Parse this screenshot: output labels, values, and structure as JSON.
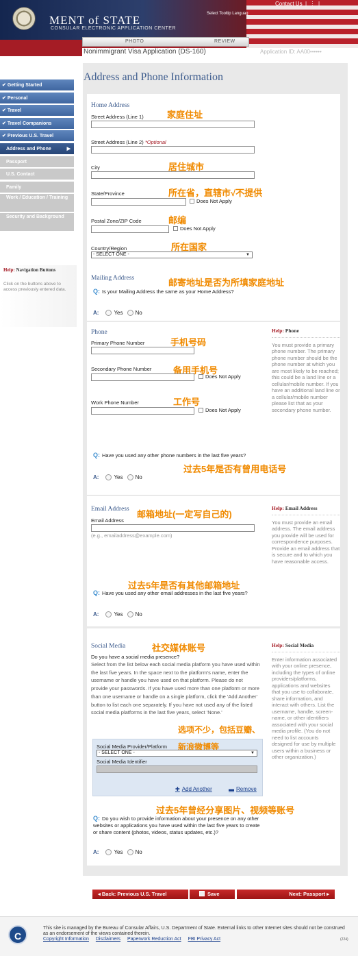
{
  "header": {
    "department": "MENT of STATE",
    "center": "CONSULAR ELECTRONIC APPLICATION CENTER",
    "contact": "Contact Us",
    "tooltip": "Select Tooltip Languag",
    "tabs": [
      "PHOTO",
      "REVIEW"
    ],
    "app_title": "Nonimmigrant Visa Application (DS-160)",
    "app_id": "Application ID: AA00••••••"
  },
  "sidebar": {
    "items": [
      {
        "label": "Getting Started",
        "state": "done"
      },
      {
        "label": "Personal",
        "state": "done"
      },
      {
        "label": "Travel",
        "state": "done"
      },
      {
        "label": "Travel Companions",
        "state": "done"
      },
      {
        "label": "Previous U.S. Travel",
        "state": "done"
      },
      {
        "label": "Address and Phone",
        "state": "current"
      },
      {
        "label": "Passport",
        "state": "pending"
      },
      {
        "label": "U.S. Contact",
        "state": "pending"
      },
      {
        "label": "Family",
        "state": "pending"
      },
      {
        "label": "Work / Education / Training",
        "state": "pending"
      },
      {
        "label": "Security and Background",
        "state": "pending"
      }
    ],
    "help_prefix": "Help:",
    "help_title": "Navigation Buttons",
    "help_text": "Click on the buttons above to access previously entered data."
  },
  "page_title": "Address and Phone Information",
  "home": {
    "heading": "Home Address",
    "street1": "Street Address (Line 1)",
    "street2": "Street Address (Line 2)",
    "optional": "*Optional",
    "city": "City",
    "state": "State/Province",
    "postal": "Postal Zone/ZIP Code",
    "country": "Country/Region",
    "does_not_apply": "Does Not Apply",
    "select_one": "- SELECT ONE -"
  },
  "mailing": {
    "heading": "Mailing Address",
    "question": "Is your Mailing Address the same as your Home Address?"
  },
  "phone": {
    "heading": "Phone",
    "primary": "Primary Phone Number",
    "secondary": "Secondary Phone Number",
    "work": "Work Phone Number",
    "question": "Have you used any other phone numbers in the last five years?",
    "help_prefix": "Help:",
    "help_title": "Phone",
    "help_text": "You must provide a primary phone number. The primary phone number should be the phone number at which you are most likely to be reached; this could be a land line or a cellular/mobile number. If you have an additional land line or a cellular/mobile number please list that as your secondary phone number."
  },
  "email": {
    "heading": "Email Address",
    "label": "Email Address",
    "example": "(e.g., emailaddress@example.com)",
    "question": "Have you used any other email addresses in the last five years?",
    "help_prefix": "Help:",
    "help_title": "Email Address",
    "help_text": "You must provide an email address. The email address you provide will be used for correspondence purposes. Provide an email address that is secure and to which you have reasonable access."
  },
  "social": {
    "heading": "Social Media",
    "presence_title": "Do you have a social media presence?",
    "presence_text": "Select from the list below each social media platform you have used within the last five years. In the space next to the platform's name, enter the username or handle you have used on that platform. Please do not provide your passwords. If you have used more than one platform or more than one username or handle on a single platform, click the 'Add Another' button to list each one separately. If you have not used any of the listed social media platforms in the last five years, select 'None.'",
    "provider_label": "Social Media Provider/Platform",
    "identifier_label": "Social Media Identifier",
    "select_one": "- SELECT ONE -",
    "add_another": "Add Another",
    "remove": "Remove",
    "question": "Do you wish to provide information about your presence on any other websites or applications you have used within the last five years to create or share content (photos, videos, status updates, etc.)?",
    "help_prefix": "Help:",
    "help_title": "Social Media",
    "help_text": "Enter information associated with your online presence, including the types of online providers/platforms, applications and websites that you use to collaborate, share information, and interact with others. List the username, handle, screen-name, or other identifiers associated with your social media profile. (You do not need to list accounts designed for use by multiple users within a business or other organization.)"
  },
  "radio": {
    "answer": "A:",
    "yes": "Yes",
    "no": "No",
    "q": "Q:"
  },
  "annotations": {
    "home": "家庭住址",
    "city": "居住城市",
    "state": "所在省，直辖市√不提供",
    "postal": "邮编",
    "country": "所在国家",
    "mailing": "邮寄地址是否为所填家庭地址",
    "primary": "手机号码",
    "secondary": "备用手机号",
    "work": "工作号",
    "other_phone": "过去5年是否有曾用电话号",
    "email": "邮箱地址(一定写自己的)",
    "other_email": "过去5年是否有其他邮箱地址",
    "social": "社交媒体账号",
    "options1": "选项不少，包括豆瓣、",
    "options2": "新浪微博等",
    "share": "过去5年曾经分享图片、视频等账号"
  },
  "nav_buttons": {
    "back": "◂ Back: Previous U.S. Travel",
    "save": "Save",
    "next": "Next: Passport ▸"
  },
  "footer": {
    "text": "This site is managed by the Bureau of Consular Affairs, U.S. Department of State. External links to other Internet sites should not be construed as an endorsement of the views contained therein.",
    "links": [
      "Copyright Information",
      "Disclaimers",
      "Paperwork Reduction Act",
      "FBI Privacy Act"
    ],
    "code": "(224)",
    "logo": "C"
  },
  "colors": {
    "brand_red": "#a51c25",
    "nav_blue": "#3f66a0",
    "heading_blue": "#3b5a8c",
    "annotation": "#f08a00"
  }
}
